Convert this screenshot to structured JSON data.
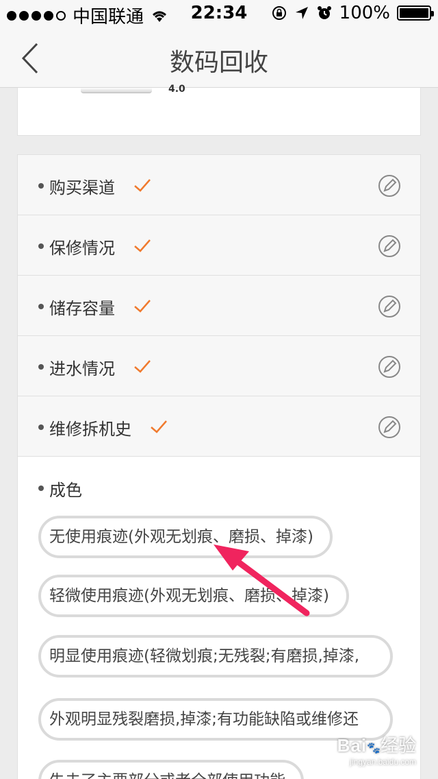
{
  "status_bar": {
    "carrier": "中国联通",
    "time": "22:34",
    "battery": "100%"
  },
  "nav": {
    "title": "数码回收"
  },
  "top_card": {
    "partial_text": "4.0"
  },
  "rows": [
    {
      "label": "购买渠道"
    },
    {
      "label": "保修情况"
    },
    {
      "label": "储存容量"
    },
    {
      "label": "进水情况"
    },
    {
      "label": "维修拆机史"
    }
  ],
  "grade": {
    "label": "成色",
    "options": [
      "无使用痕迹(外观无划痕、磨损、掉漆)",
      "轻微使用痕迹(外观无划痕、磨损、掉漆)",
      "明显使用痕迹(轻微划痕;无残裂;有磨损,掉漆,",
      "外观明显残裂磨损,掉漆;有功能缺陷或维修还",
      "失去了主要部分或者全部使用功能"
    ]
  },
  "colors": {
    "check": "#f07a2e",
    "arrow": "#f0245e"
  },
  "watermark": {
    "brand": "Bai",
    "brand2": "经验",
    "sub": "jingyan.baidu.com"
  }
}
